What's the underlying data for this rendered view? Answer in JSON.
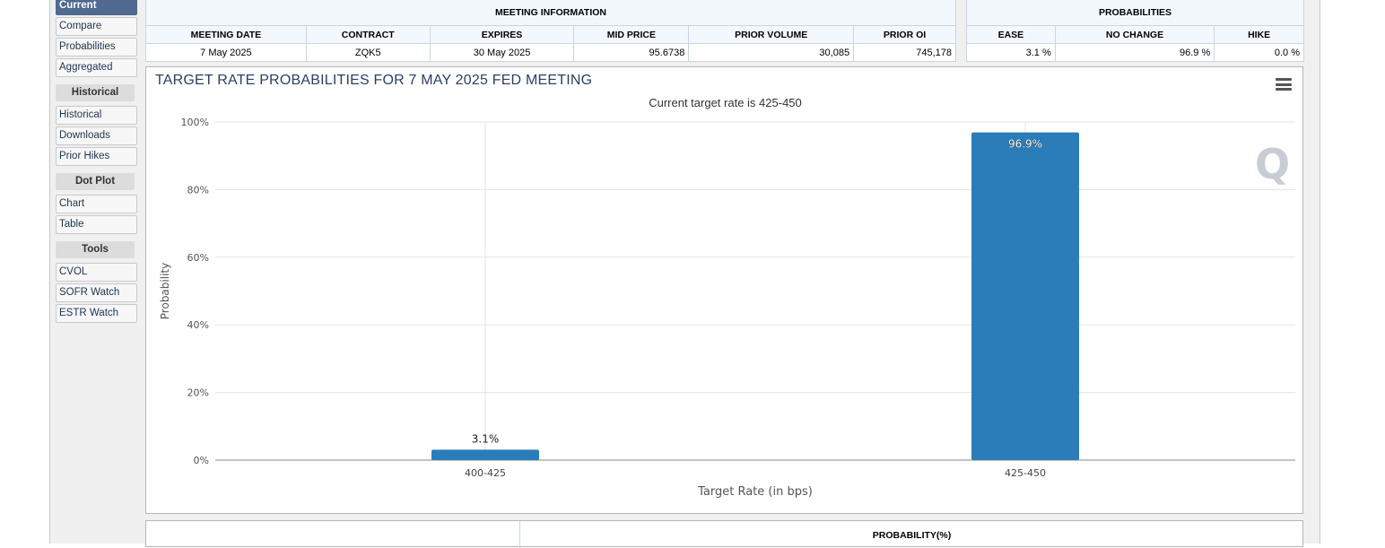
{
  "sidebar": {
    "items_top": [
      "Current",
      "Compare",
      "Probabilities",
      "Aggregated"
    ],
    "sections": [
      {
        "title": "Historical",
        "items": [
          "Historical",
          "Downloads",
          "Prior Hikes"
        ]
      },
      {
        "title": "Dot Plot",
        "items": [
          "Chart",
          "Table"
        ]
      },
      {
        "title": "Tools",
        "items": [
          "CVOL",
          "SOFR Watch",
          "ESTR Watch"
        ]
      }
    ]
  },
  "meeting_info": {
    "header": "MEETING INFORMATION",
    "columns": [
      "MEETING DATE",
      "CONTRACT",
      "EXPIRES",
      "MID PRICE",
      "PRIOR VOLUME",
      "PRIOR OI"
    ],
    "row": [
      "7 May 2025",
      "ZQK5",
      "30 May 2025",
      "95.6738",
      "30,085",
      "745,178"
    ]
  },
  "probabilities": {
    "header": "PROBABILITIES",
    "columns": [
      "EASE",
      "NO CHANGE",
      "HIKE"
    ],
    "row": [
      "3.1 %",
      "96.9 %",
      "0.0 %"
    ]
  },
  "chart_panel": {
    "title": "TARGET RATE PROBABILITIES FOR 7 MAY 2025 FED MEETING"
  },
  "bottom_panel": {
    "header": "PROBABILITY(%)"
  },
  "colors": {
    "bar": "#2a7db8",
    "title": "#2c3e64",
    "active_nav": "#4f6a8e"
  },
  "chart_data": {
    "type": "bar",
    "title": "TARGET RATE PROBABILITIES FOR 7 MAY 2025 FED MEETING",
    "subtitle": "Current target rate is 425-450",
    "categories": [
      "400-425",
      "425-450"
    ],
    "values": [
      3.1,
      96.9
    ],
    "data_labels": [
      "3.1%",
      "96.9%"
    ],
    "xlabel": "Target Rate (in bps)",
    "ylabel": "Probability",
    "ylim": [
      0,
      100
    ],
    "yticks": [
      0,
      20,
      40,
      60,
      80,
      100
    ],
    "ytick_labels": [
      "0%",
      "20%",
      "40%",
      "60%",
      "80%",
      "100%"
    ],
    "grid": true,
    "watermark": "Q"
  }
}
